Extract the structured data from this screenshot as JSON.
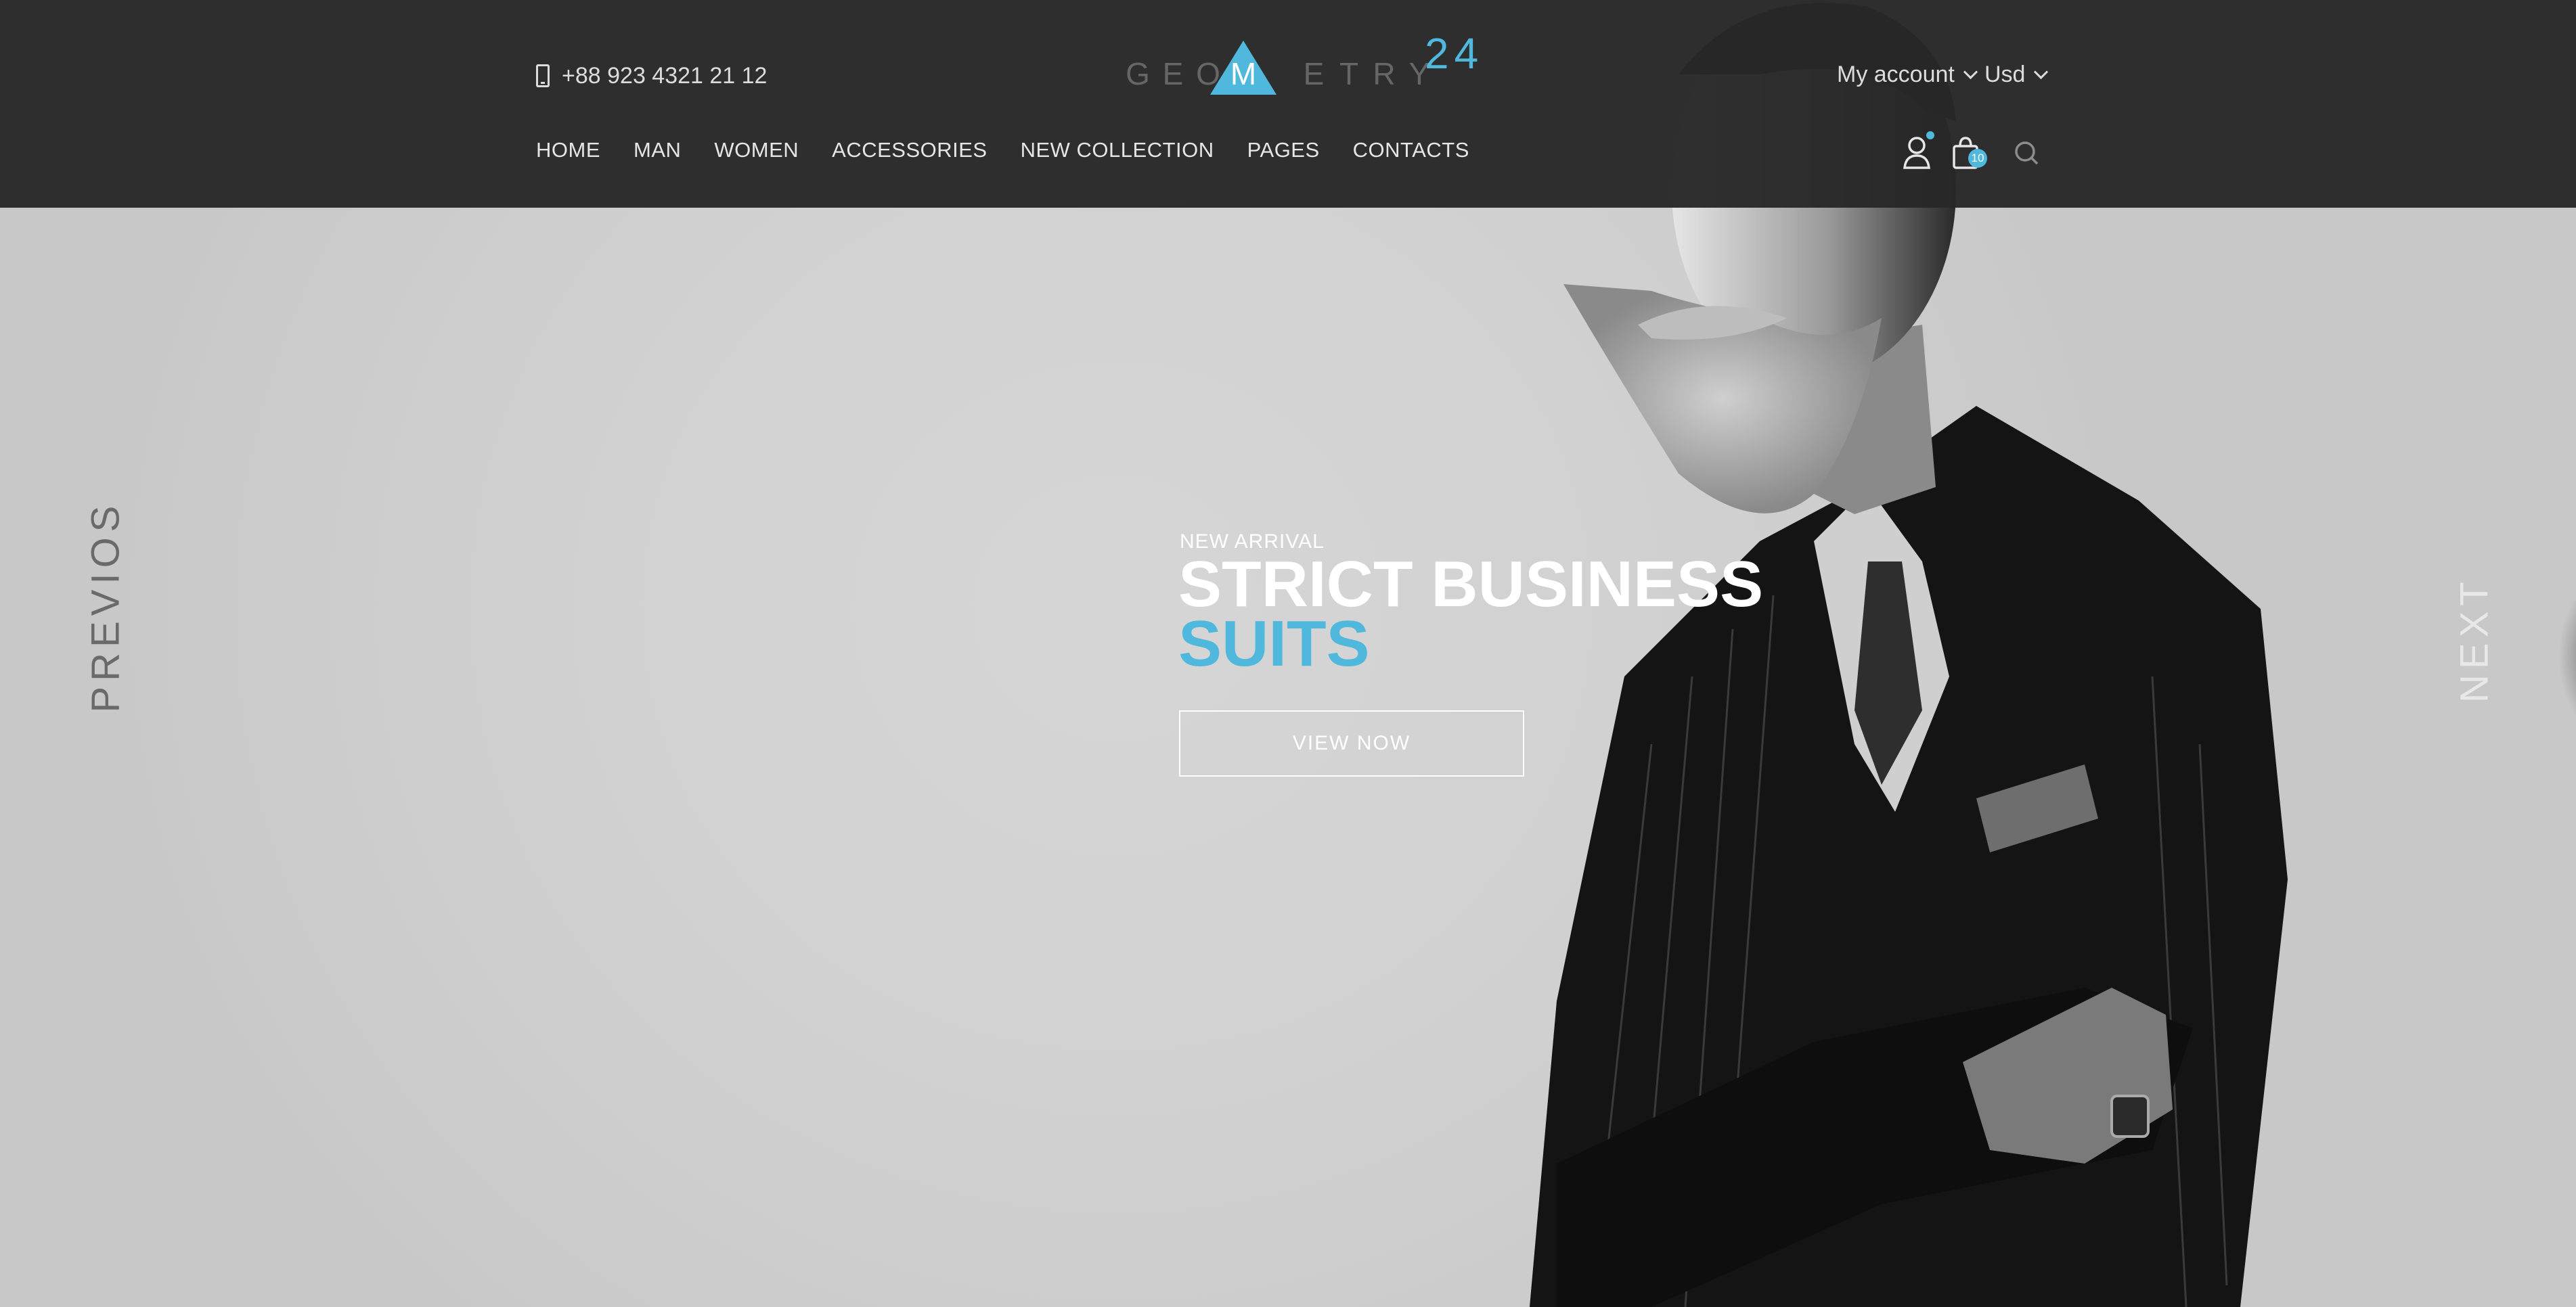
{
  "header": {
    "phone": "+88 923 4321 21 12",
    "logo": {
      "letters_left": [
        "G",
        "E",
        "O"
      ],
      "accent_letter": "M",
      "letters_right": [
        "E",
        "T",
        "R",
        "Y"
      ],
      "number": "24"
    },
    "account_label": "My account",
    "currency_label": "Usd",
    "nav": [
      "HOME",
      "MAN",
      "WOMEN",
      "ACCESSORIES",
      "NEW COLLECTION",
      "PAGES",
      "CONTACTS"
    ],
    "cart_count": "10"
  },
  "hero": {
    "kicker": "NEW ARRIVAL",
    "headline": "STRICT BUSINESS",
    "headline_accent": "SUITS",
    "cta_label": "VIEW NOW",
    "prev_label": "PREVIOS",
    "next_label": "NEXT"
  },
  "colors": {
    "accent": "#4fb8dc",
    "header_bg": "#282828",
    "hero_bg": "#d1d1d1"
  },
  "icons": {
    "phone": "phone-icon",
    "user": "user-icon",
    "cart": "shopping-bag-icon",
    "search": "search-icon"
  }
}
